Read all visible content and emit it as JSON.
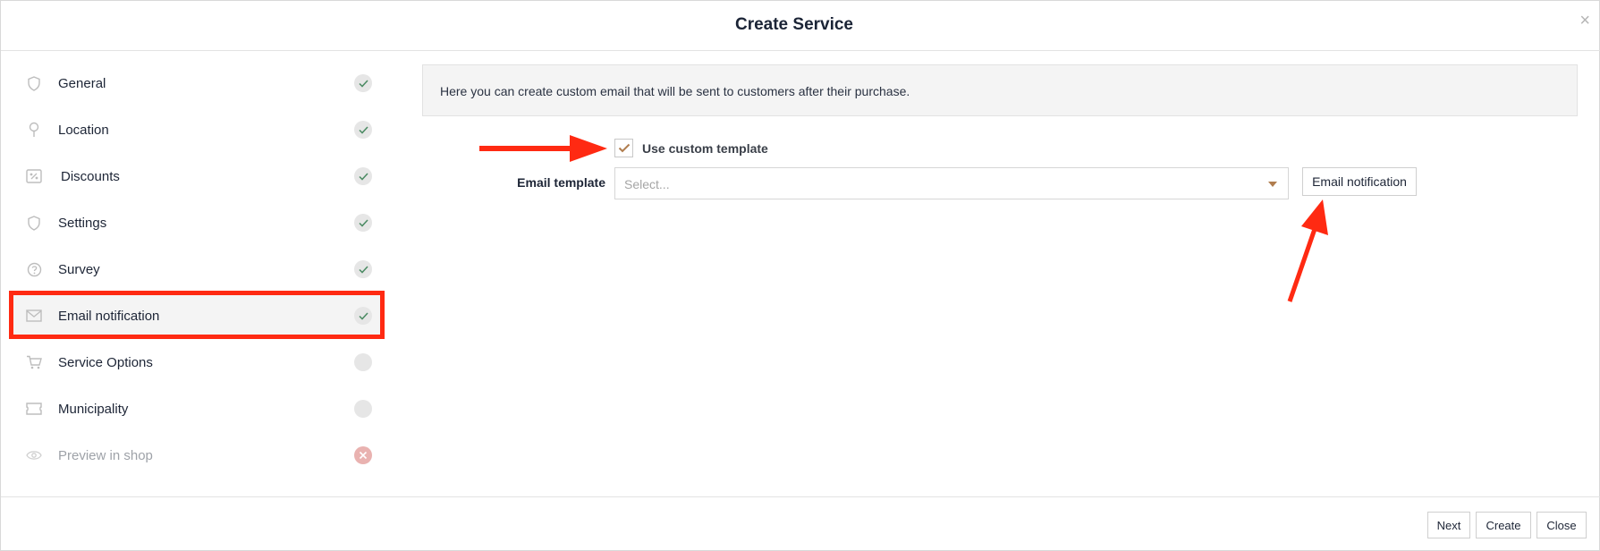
{
  "dialog": {
    "title": "Create Service",
    "close_glyph": "×"
  },
  "sidebar": {
    "items": [
      {
        "label": "General",
        "icon": "shield-icon",
        "status": "done"
      },
      {
        "label": "Location",
        "icon": "pin-icon",
        "status": "done"
      },
      {
        "label": "Discounts",
        "icon": "percent-tag-icon",
        "status": "done"
      },
      {
        "label": "Settings",
        "icon": "shield-icon",
        "status": "done"
      },
      {
        "label": "Survey",
        "icon": "question-circle-icon",
        "status": "done"
      },
      {
        "label": "Email notification",
        "icon": "envelope-icon",
        "status": "done",
        "active": true
      },
      {
        "label": "Service Options",
        "icon": "cart-icon",
        "status": "pending"
      },
      {
        "label": "Municipality",
        "icon": "ticket-icon",
        "status": "pending"
      },
      {
        "label": "Preview in shop",
        "icon": "eye-icon",
        "status": "error"
      }
    ]
  },
  "main": {
    "info_text": "Here you can create custom email that will be sent to customers after their purchase.",
    "use_custom_template": {
      "label": "Use custom template",
      "checked": true
    },
    "email_template": {
      "label": "Email template",
      "placeholder": "Select..."
    },
    "email_notification_button": "Email notification"
  },
  "footer": {
    "next_label": "Next",
    "create_label": "Create",
    "close_label": "Close"
  },
  "colors": {
    "accent": "#b07d4e",
    "check_done": "#4a8a62",
    "error": "#e9b2b0",
    "annotation_red": "#ff2a12"
  }
}
